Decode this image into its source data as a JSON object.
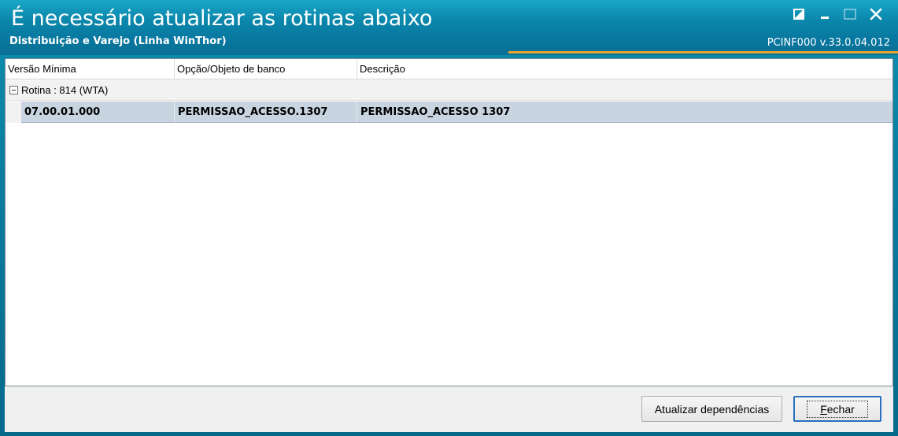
{
  "window": {
    "title": "É necessário atualizar as rotinas abaixo",
    "subtitle": "Distribuição e Varejo (Linha WinThor)",
    "version": "PCINF000  v.33.0.04.012",
    "accent_color": "#e6a52e",
    "titlebar_color": "#0b88ac"
  },
  "window_controls": {
    "restore_icon": "restore-icon",
    "minimize_icon": "minimize-icon",
    "maximize_icon": "maximize-icon",
    "close_icon": "close-icon"
  },
  "grid": {
    "columns": [
      "Versão Mínima",
      "Opção/Objeto de banco",
      "Descrição"
    ],
    "group": {
      "label": "Rotina : 814 (WTA)",
      "expanded": true
    },
    "rows": [
      {
        "versao_minima": "07.00.01.000",
        "opcao_objeto": "PERMISSAO_ACESSO.1307",
        "descricao": "PERMISSAO_ACESSO 1307",
        "selected": true
      }
    ],
    "selected_row_color": "#c8d4e0"
  },
  "buttons": {
    "update_label": "Atualizar dependências",
    "close_label": "Fechar"
  }
}
